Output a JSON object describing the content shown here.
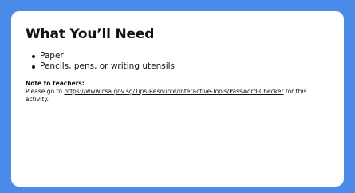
{
  "slide": {
    "title": "What You’ll Need",
    "items": [
      {
        "label": "Paper"
      },
      {
        "label": "Pencils, pens, or writing utensils"
      }
    ],
    "notes": {
      "heading": "Note to teachers:",
      "before_link": "Please go to ",
      "link_text": "https://www.csa.gov.sg/Tips-Resource/Interactive-Tools/Password-Checker",
      "after_link": " for this activity."
    }
  },
  "colors": {
    "frame": "#4a8ae8",
    "card": "#ffffff",
    "text": "#111111"
  }
}
